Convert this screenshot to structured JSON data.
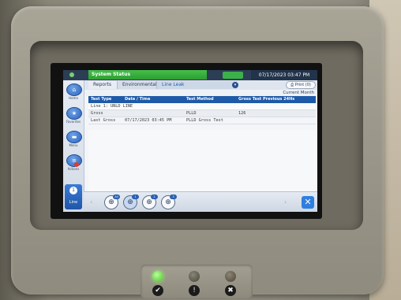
{
  "header": {
    "title": "System Status",
    "badge": "",
    "datetime": "07/17/2023 03:47 PM"
  },
  "breadcrumb": [
    "Reports",
    "Environmental",
    "Line Leak"
  ],
  "toolbar": {
    "print_label": "Print (0)",
    "period": "Current Month"
  },
  "nav": {
    "items": [
      {
        "label": "Home",
        "icon": "home-icon"
      },
      {
        "label": "Favorites",
        "icon": "star-icon"
      },
      {
        "label": "Menu",
        "icon": "menu-icon"
      },
      {
        "label": "Actions",
        "icon": "actions-icon"
      }
    ],
    "line": {
      "number": "1",
      "label": "Line"
    }
  },
  "table": {
    "headers": [
      "Test Type",
      "Date / Time",
      "Test Method",
      "Gross Test Previous 24Hs"
    ],
    "group_row": "Line 1: UNLD LINE",
    "rows": [
      [
        "Gross",
        "",
        "PLLD",
        "126"
      ],
      [
        "Last Gross",
        "07/17/2023 03:45 PM",
        "PLLD Gross Test",
        ""
      ]
    ]
  },
  "bottom_bar": {
    "gauges": [
      {
        "tag": "All",
        "selected": false
      },
      {
        "tag": "1",
        "selected": true
      },
      {
        "tag": "2",
        "selected": false
      },
      {
        "tag": "3",
        "selected": false
      }
    ]
  },
  "indicators": [
    {
      "name": "power",
      "color": "#4dbb2a",
      "lit": true,
      "icon": "check-icon"
    },
    {
      "name": "warning",
      "color": "#474539",
      "lit": false,
      "icon": "exclamation-icon"
    },
    {
      "name": "alarm",
      "color": "#4a4438",
      "lit": false,
      "icon": "x-icon"
    }
  ]
}
